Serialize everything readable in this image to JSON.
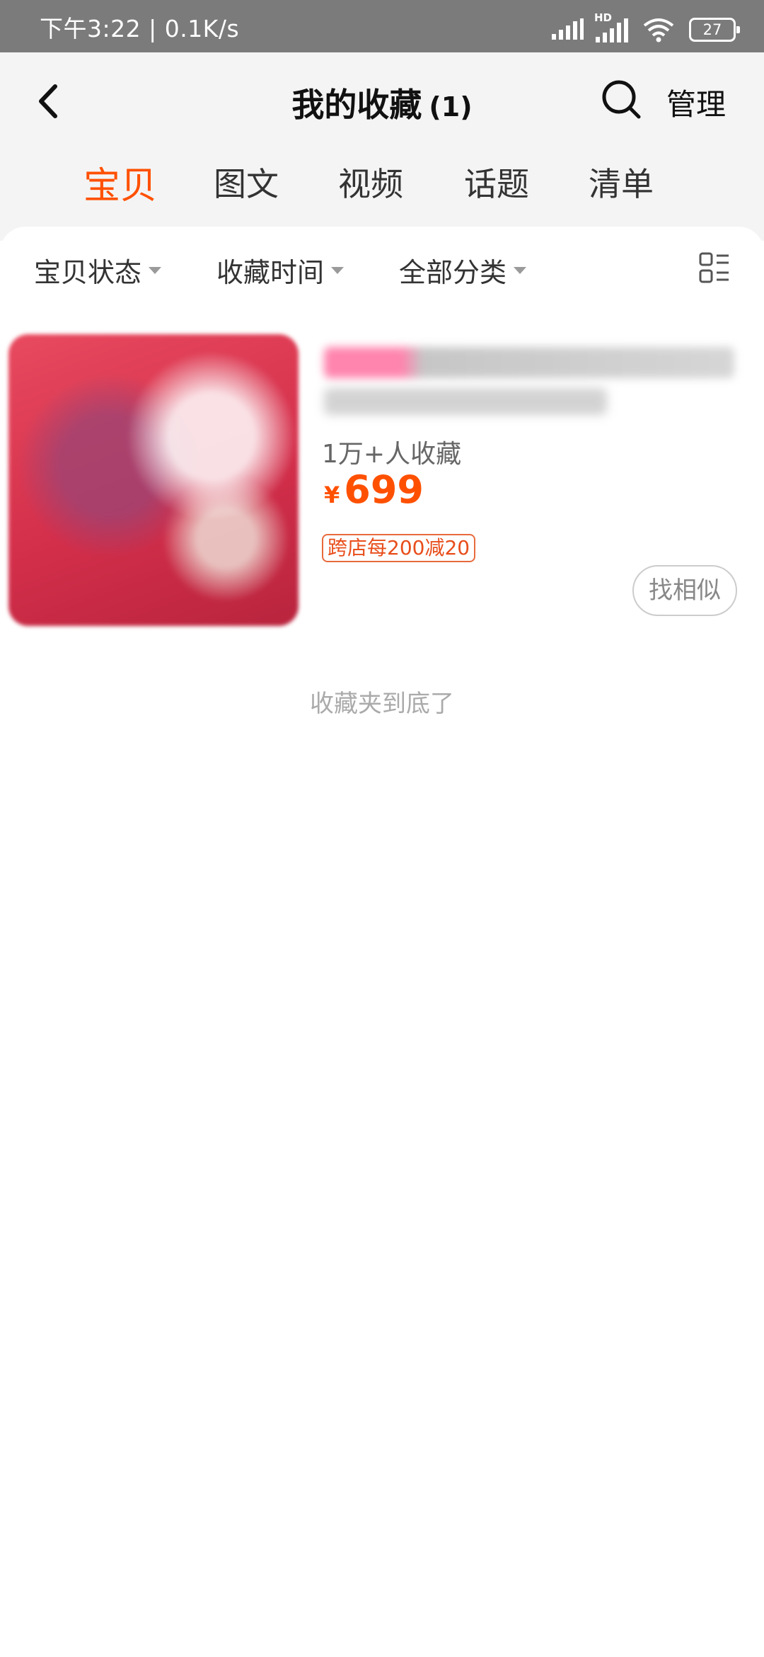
{
  "status_bar": {
    "time_speed": "下午3:22 | 0.1K/s",
    "network_label": "HD",
    "battery_level": "27"
  },
  "header": {
    "title": "我的收藏",
    "count": "(1)",
    "manage_label": "管理"
  },
  "tabs": [
    {
      "label": "宝贝",
      "active": true
    },
    {
      "label": "图文",
      "active": false
    },
    {
      "label": "视频",
      "active": false
    },
    {
      "label": "话题",
      "active": false
    },
    {
      "label": "清单",
      "active": false
    }
  ],
  "filters": [
    {
      "label": "宝贝状态"
    },
    {
      "label": "收藏时间"
    },
    {
      "label": "全部分类"
    }
  ],
  "product": {
    "fav_count": "1万+人收藏",
    "currency": "¥",
    "price": "699",
    "promo": "跨店每200减20",
    "similar_label": "找相似"
  },
  "footer": {
    "end_text": "收藏夹到底了"
  },
  "colors": {
    "accent": "#ff5000",
    "status_bar": "#7b7b7b",
    "header_bg": "#f4f4f4"
  },
  "icons": [
    "back-arrow-icon",
    "search-icon",
    "list-layout-icon",
    "signal-icon",
    "wifi-icon",
    "battery-icon"
  ]
}
